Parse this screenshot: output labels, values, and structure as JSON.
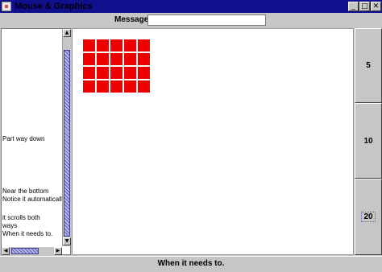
{
  "window": {
    "title": "Mouse & Graphics",
    "controls": {
      "minimize": "_",
      "maximize": "□",
      "close": "✕"
    }
  },
  "message": {
    "label": "Message:",
    "value": "",
    "placeholder": ""
  },
  "left_panel": {
    "lines": [
      "Part way down",
      "",
      "",
      "",
      "",
      "",
      "Near the bottom",
      "Notice it automatically",
      "",
      "it scrolls both",
      "ways",
      "When it needs to."
    ]
  },
  "canvas": {
    "grid_rows": 4,
    "grid_cols": 5,
    "square_color": "#ee0000"
  },
  "right_buttons": [
    {
      "label": "5"
    },
    {
      "label": "10"
    },
    {
      "label": "20"
    }
  ],
  "status": "When it needs to."
}
